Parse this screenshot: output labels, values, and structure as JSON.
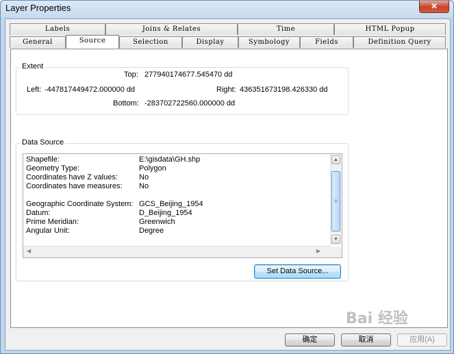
{
  "window": {
    "title": "Layer Properties",
    "close_glyph": "✕"
  },
  "tabs": {
    "back_row": [
      "Labels",
      "Joins & Relates",
      "Time",
      "HTML Popup"
    ],
    "front_row": [
      "General",
      "Source",
      "Selection",
      "Display",
      "Symbology",
      "Fields",
      "Definition Query"
    ],
    "active": "Source"
  },
  "extent": {
    "title": "Extent",
    "top_label": "Top:",
    "top_value": "277940174677.545470 dd",
    "left_label": "Left:",
    "left_value": "-447817449472.000000 dd",
    "right_label": "Right:",
    "right_value": "436351673198.426330 dd",
    "bottom_label": "Bottom:",
    "bottom_value": "-283702722560.000000 dd"
  },
  "data_source": {
    "title": "Data Source",
    "rows": [
      {
        "key": "Shapefile:",
        "value": "E:\\gisdata\\GH.shp"
      },
      {
        "key": "Geometry Type:",
        "value": "Polygon"
      },
      {
        "key": "Coordinates have Z values:",
        "value": "No"
      },
      {
        "key": "Coordinates have measures:",
        "value": "No"
      },
      {
        "key": "",
        "value": ""
      },
      {
        "key": "Geographic Coordinate System:",
        "value": "GCS_Beijing_1954"
      },
      {
        "key": "Datum:",
        "value": "D_Beijing_1954"
      },
      {
        "key": "Prime Meridian:",
        "value": "Greenwich"
      },
      {
        "key": "Angular Unit:",
        "value": "Degree"
      }
    ],
    "set_button": "Set Data Source..."
  },
  "footer": {
    "ok": "确定",
    "cancel": "取消",
    "apply": "应用(A)"
  },
  "watermark": "Bai 经验"
}
